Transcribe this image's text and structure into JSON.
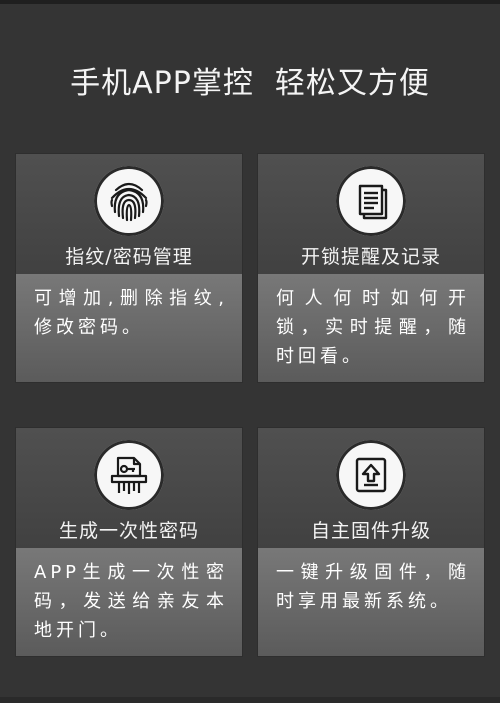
{
  "headline": "手机APP掌控  轻松又方便",
  "cards": [
    {
      "icon": "fingerprint-icon",
      "title": "指纹/密码管理",
      "desc": "可增加,删除指纹,修改密码。"
    },
    {
      "icon": "document-icon",
      "title": "开锁提醒及记录",
      "desc": "何人何时如何开锁，实时提醒，随时回看。"
    },
    {
      "icon": "one-time-password-icon",
      "title": "生成一次性密码",
      "desc": "APP生成一次性密码，发送给亲友本地开门。"
    },
    {
      "icon": "upgrade-icon",
      "title": "自主固件升级",
      "desc": "一键升级固件，随时享用最新系统。"
    }
  ]
}
